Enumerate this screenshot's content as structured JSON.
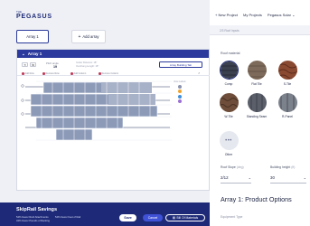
{
  "app": {
    "logo_small": "THE",
    "logo_main": "PEGASUS"
  },
  "arrays": {
    "tabs": [
      "Array 1"
    ],
    "add_label": "Add array"
  },
  "editor": {
    "header_title": "Array 1",
    "pitch_label": "Pitch angle",
    "pitch_value": "19",
    "meta_line1": "Gutter Distance: 18\"",
    "meta_line2": "Overhang Length: 18\"",
    "array_button": "Array Building Tab",
    "tools": [
      "Add Row",
      "Remove Row",
      "Add Column",
      "Remove Column"
    ],
    "legend_label": "Row Labels"
  },
  "nav": {
    "new_project": "New Project",
    "my_projects": "My Projects",
    "account": "Pegasus Solar"
  },
  "right": {
    "roof_inputs_tab": "2/3 Roof Inputs",
    "roof_material_label": "Roof material",
    "materials": [
      "Comp",
      "Flat Tile",
      "S-Tile",
      "W-Tile",
      "Standing Seam",
      "R-Panel",
      "Other"
    ],
    "selected_material": "Comp",
    "roof_slope_label": "Roof Slope",
    "roof_slope_unit": "(deg)",
    "roof_slope_value": "2/12",
    "building_height_label": "Building height",
    "building_height_unit": "(ft)",
    "building_height_value": "30",
    "options_title": "Array 1: Product Options",
    "equipment_type": "Equipment Type"
  },
  "savings": {
    "title": "SkipRail Savings",
    "stats": [
      "54% Fewer Roof Attachments",
      "54% Fewer Feet of Rail",
      "34% Fewer Pounds of Racking"
    ]
  },
  "actions": {
    "save": "Save",
    "cancel": "Cancel",
    "bom": "Bill Of Materials"
  },
  "colors": {
    "brand": "#1e2a78",
    "accent": "#2b3a9c",
    "panel": "#7a8aa8",
    "background": "#eef0f5"
  }
}
